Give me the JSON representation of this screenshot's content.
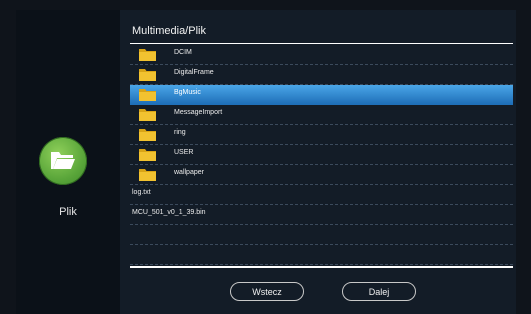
{
  "left_panel": {
    "label": "Plik",
    "icon": "folder-icon"
  },
  "header": {
    "path": "Multimedia/Plik"
  },
  "files": [
    {
      "name": "DCIM",
      "type": "folder",
      "selected": false
    },
    {
      "name": "DigitalFrame",
      "type": "folder",
      "selected": false
    },
    {
      "name": "BgMusic",
      "type": "folder",
      "selected": true
    },
    {
      "name": "MessageImport",
      "type": "folder",
      "selected": false
    },
    {
      "name": "ring",
      "type": "folder",
      "selected": false
    },
    {
      "name": "USER",
      "type": "folder",
      "selected": false
    },
    {
      "name": "wallpaper",
      "type": "folder",
      "selected": false
    },
    {
      "name": "log.txt",
      "type": "file",
      "selected": false
    },
    {
      "name": "MCU_501_v0_1_39.bin",
      "type": "file",
      "selected": false
    }
  ],
  "buttons": {
    "back": "Wstecz",
    "next": "Dalej"
  },
  "colors": {
    "selection": "#2f86d0",
    "folder": "#f2c230",
    "icon_circle": "#5aa63a"
  }
}
